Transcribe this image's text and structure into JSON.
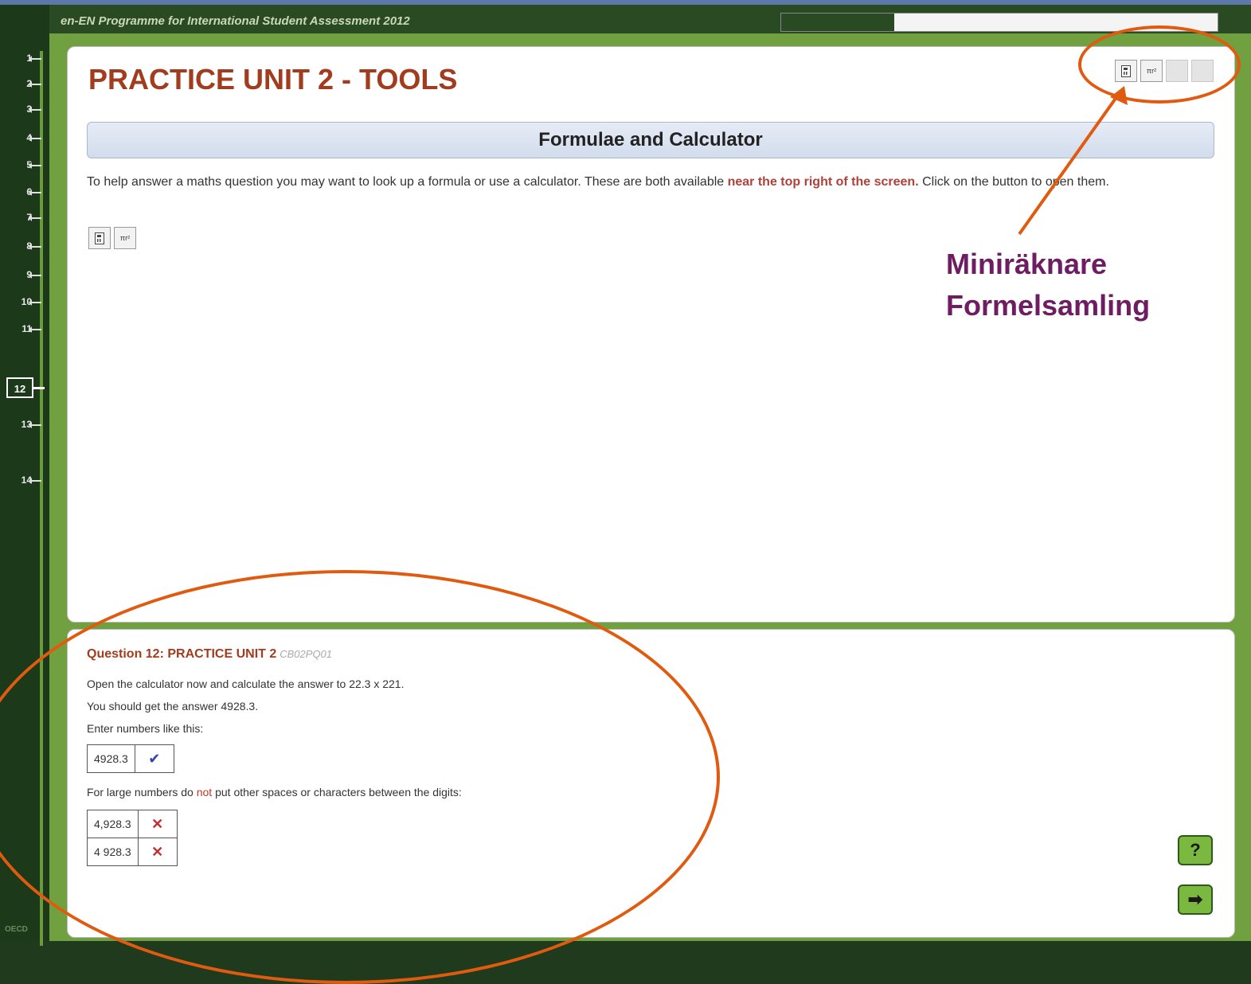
{
  "header": {
    "title": "en-EN Programme for International Student Assessment 2012",
    "progress_fraction": 0.26
  },
  "nav": {
    "items": [
      "1",
      "2",
      "3",
      "4",
      "5",
      "6",
      "7",
      "8",
      "9",
      "10",
      "11",
      "12",
      "13",
      "14"
    ],
    "current": "12",
    "footer_logo": "OECD"
  },
  "unit": {
    "title": "PRACTICE UNIT 2 - TOOLS",
    "section_title": "Formulae and Calculator",
    "intro_before": "To help answer a maths question you may want to look up a formula or use a calculator. These are both available ",
    "intro_highlight": "near the top right of the screen.",
    "intro_after": " Click on the button to open them."
  },
  "toolbar": {
    "calculator_icon": "calculator-icon",
    "formula_icon": "formula-pi-r-squared-icon",
    "formula_label": "πr²"
  },
  "annotation": {
    "line1": "Miniräknare",
    "line2": "Formelsamling",
    "color": "#6e1d62",
    "ring_color": "#e05a10"
  },
  "question": {
    "title": "Question 12: PRACTICE UNIT 2",
    "code": "CB02PQ01",
    "line1": "Open the calculator now and calculate the answer to 22.3 x 221.",
    "line2": "You should get the answer 4928.3.",
    "line3": "Enter numbers like this:",
    "good_example": "4928.3",
    "good_mark": "✔",
    "line4_before": "For large numbers do ",
    "line4_red": "not",
    "line4_after": " put other spaces or characters between the digits:",
    "bad_example_1": "4,928.3",
    "bad_example_2": "4 928.3",
    "bad_mark": "✕"
  },
  "buttons": {
    "help_label": "?",
    "next_label": "➡"
  }
}
